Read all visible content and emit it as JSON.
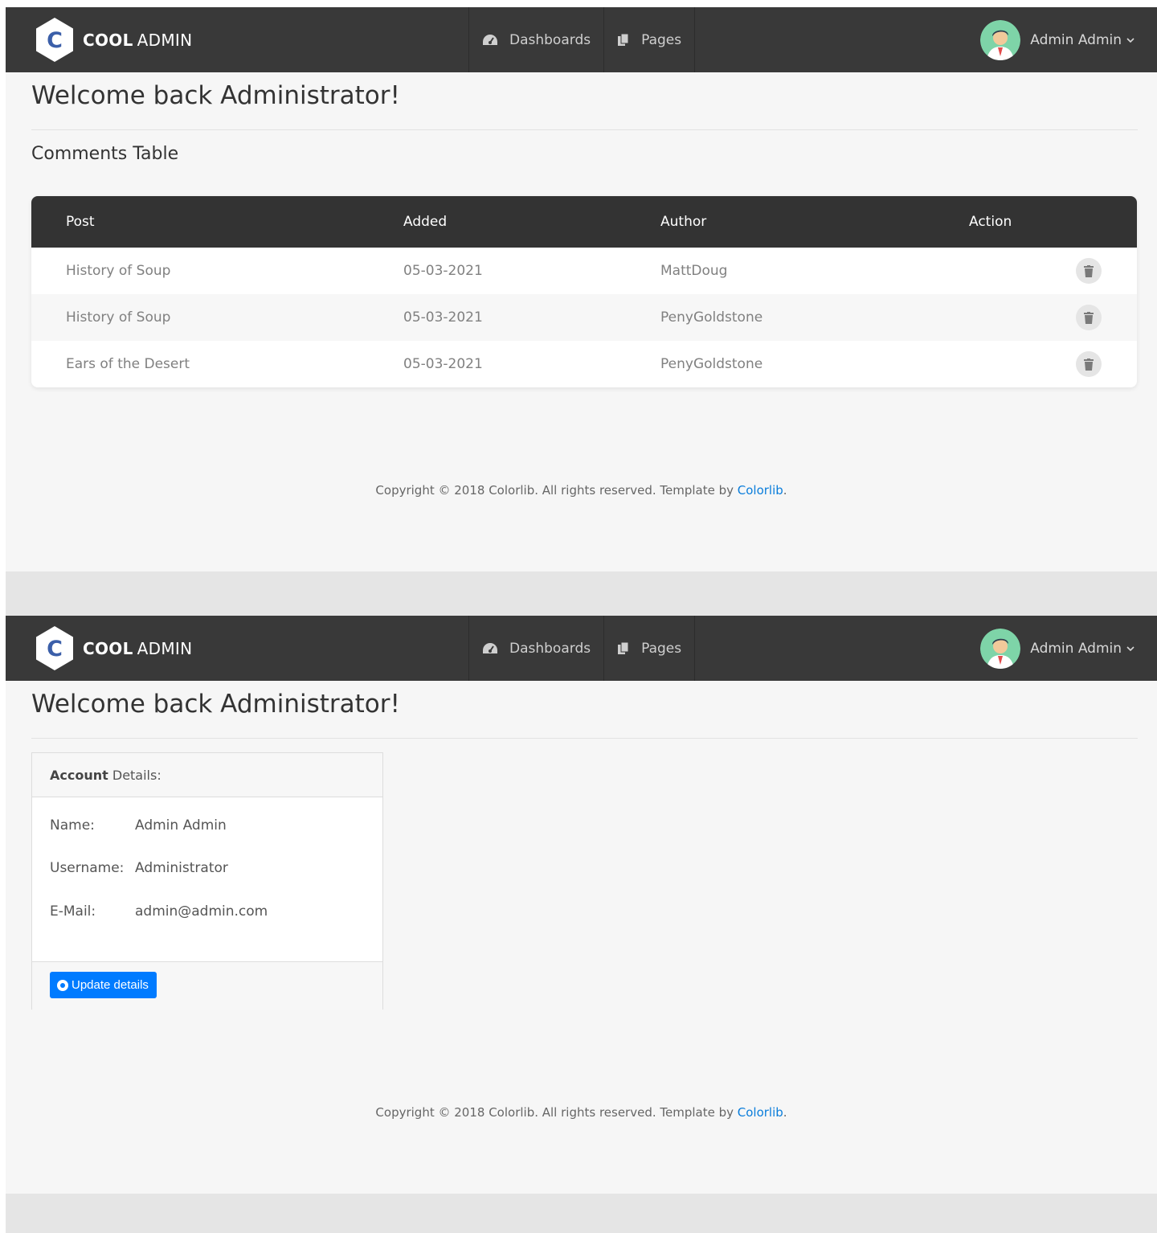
{
  "brand": {
    "bold": "COOL",
    "light": "ADMIN",
    "letter": "C"
  },
  "nav": {
    "dashboards": "Dashboards",
    "pages": "Pages"
  },
  "user": {
    "name": "Admin Admin"
  },
  "welcome": "Welcome back Administrator!",
  "comments": {
    "title": "Comments Table",
    "columns": [
      "Post",
      "Added",
      "Author",
      "Action"
    ],
    "rows": [
      {
        "post": "History of Soup",
        "added": "05-03-2021",
        "author": "MattDoug"
      },
      {
        "post": "History of Soup",
        "added": "05-03-2021",
        "author": "PenyGoldstone"
      },
      {
        "post": "Ears of the Desert",
        "added": "05-03-2021",
        "author": "PenyGoldstone"
      }
    ]
  },
  "account": {
    "title_bold": "Account",
    "title_rest": " Details:",
    "fields": [
      {
        "label": "Name:",
        "value": "Admin Admin"
      },
      {
        "label": "Username:",
        "value": "Administrator"
      },
      {
        "label": "E-Mail:",
        "value": "admin@admin.com"
      }
    ],
    "update_label": "Update details"
  },
  "footer": {
    "text": "Copyright © 2018 Colorlib. All rights reserved. Template by ",
    "link": "Colorlib",
    "end": "."
  },
  "colors": {
    "header": "#393939",
    "table_head": "#333333",
    "link": "#0a7ddb",
    "button": "#007bff"
  }
}
